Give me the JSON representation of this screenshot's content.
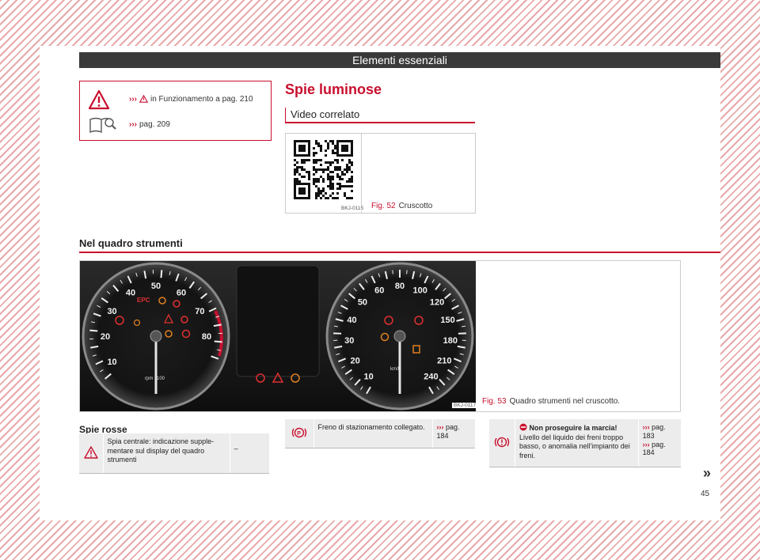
{
  "header": {
    "title": "Elementi essenziali"
  },
  "note_box": {
    "row1": {
      "arrows": "›››",
      "text": "in Funzionamento a pag. 210"
    },
    "row2": {
      "arrows": "›››",
      "text": "pag. 209"
    }
  },
  "title": "Spie luminose",
  "video": {
    "subtitle": "Video correlato",
    "fig_num": "Fig. 52",
    "fig_caption": "Cruscotto",
    "code": "BKJ-0115"
  },
  "cluster": {
    "section_title": "Nel quadro strumenti",
    "fig_num": "Fig. 53",
    "fig_caption": "Quadro strumenti nel cruscotto.",
    "code": "BKJ-0117",
    "rpm_labels": [
      "10",
      "20",
      "30",
      "40",
      "50",
      "60",
      "70",
      "80"
    ],
    "rpm_unit": "rpm x100",
    "speed_labels": [
      "10",
      "20",
      "30",
      "40",
      "50",
      "60",
      "80",
      "100",
      "120",
      "150",
      "180",
      "210",
      "240"
    ],
    "speed_unit": "km/h"
  },
  "red_lights": {
    "heading": "Spie rosse",
    "table1": {
      "desc": "Spia centrale: indicazione supple-mentare sul display del quadro strumenti",
      "ref": "–"
    },
    "table2": {
      "desc": "Freno di stazionamento collegato.",
      "ref_arrows": "›››",
      "ref_text": "pag. 184"
    },
    "table3": {
      "lead": "Non proseguire la marcia!",
      "desc": "Livello del liquido dei freni troppo basso, o anomalia nell'impianto dei freni.",
      "ref1_arrows": "›››",
      "ref1_text": "pag. 183",
      "ref2_arrows": "›››",
      "ref2_text": "pag. 184"
    }
  },
  "continue_mark": "»",
  "page_number": "45",
  "colors": {
    "accent": "#c8102e",
    "header": "#3a3a3a",
    "table_bg": "#ececec"
  }
}
